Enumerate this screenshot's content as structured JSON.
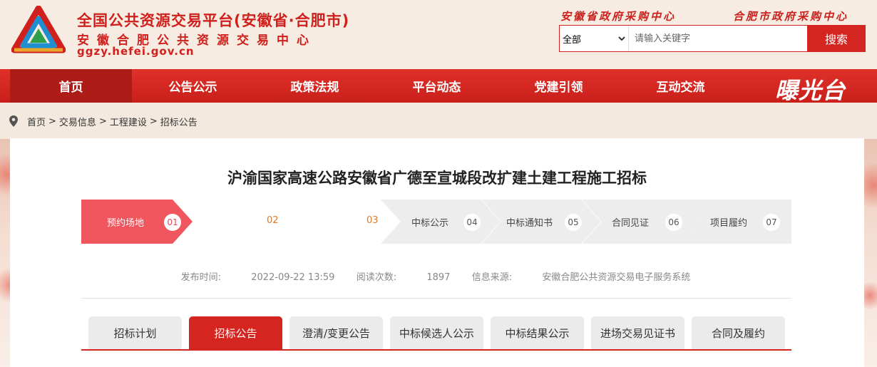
{
  "header": {
    "title": "全国公共资源交易平台(安徽省·合肥市)",
    "subtitle": "安徽合肥公共资源交易中心",
    "domain": "ggzy.hefei.gov.cn",
    "top_links": [
      "安徽省政府采购中心",
      "合肥市政府采购中心"
    ],
    "search": {
      "scope": "全部",
      "placeholder": "请输入关键字",
      "button": "搜索"
    }
  },
  "nav": {
    "items": [
      "首页",
      "公告公示",
      "政策法规",
      "平台动态",
      "党建引领",
      "互动交流"
    ],
    "active_index": 0,
    "brand": "曝光台"
  },
  "breadcrumb": [
    "首页",
    "交易信息",
    "工程建设",
    "招标公告"
  ],
  "article": {
    "title": "沪渝国家高速公路安徽省广德至宣城段改扩建土建工程施工招标",
    "steps": [
      {
        "label": "预约场地",
        "num": "01"
      },
      {
        "label": "",
        "num": "02"
      },
      {
        "label": "",
        "num": "03"
      },
      {
        "label": "中标公示",
        "num": "04"
      },
      {
        "label": "中标通知书",
        "num": "05"
      },
      {
        "label": "合同见证",
        "num": "06"
      },
      {
        "label": "项目履约",
        "num": "07"
      }
    ],
    "meta": {
      "publish_label": "发布时间:",
      "publish_value": "2022-09-22 13:59",
      "views_label": "阅读次数:",
      "views_value": "1897",
      "source_label": "信息来源:",
      "source_value": "安徽合肥公共资源交易电子服务系统"
    },
    "tabs": [
      "招标计划",
      "招标公告",
      "澄清/变更公告",
      "中标候选人公示",
      "中标结果公示",
      "进场交易见证书",
      "合同及履约"
    ],
    "active_tab": 1
  },
  "colors": {
    "brand_red": "#d42520",
    "step_active": "#f0565e",
    "step_bg": "#ededed"
  }
}
